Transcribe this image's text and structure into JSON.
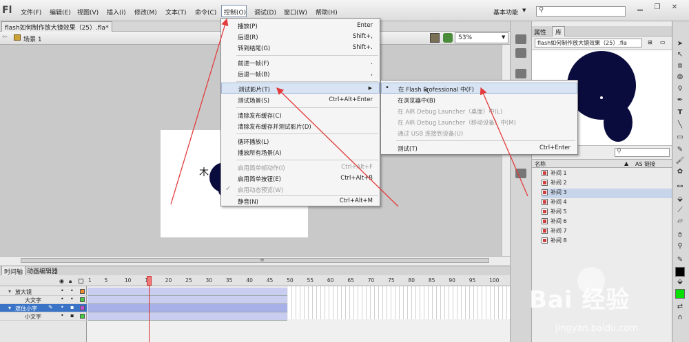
{
  "app": {
    "logo": "Fl"
  },
  "menubar": {
    "items": [
      "文件(F)",
      "编辑(E)",
      "视图(V)",
      "插入(I)",
      "修改(M)",
      "文本(T)",
      "命令(C)",
      "控制(O)",
      "调试(D)",
      "窗口(W)",
      "帮助(H)"
    ],
    "workspace": "基本功能"
  },
  "document": {
    "tab_title": "flash如何制作放大镜效果（25）.fla*",
    "scene": "场景 1",
    "zoom": "53%",
    "stage_glyph": "木"
  },
  "control_menu": {
    "items": [
      {
        "label": "播放(P)",
        "shortcut": "Enter"
      },
      {
        "label": "后退(R)",
        "shortcut": "Shift+,"
      },
      {
        "label": "转到结尾(G)",
        "shortcut": "Shift+."
      },
      {
        "label": "前进一帧(F)",
        "shortcut": "."
      },
      {
        "label": "后退一帧(B)",
        "shortcut": ","
      },
      {
        "label": "测试影片(T)",
        "shortcut": ""
      },
      {
        "label": "测试场景(S)",
        "shortcut": "Ctrl+Alt+Enter"
      },
      {
        "label": "清除发布缓存(C)",
        "shortcut": ""
      },
      {
        "label": "清除发布缓存并测试影片(D)",
        "shortcut": ""
      },
      {
        "label": "循环播放(L)",
        "shortcut": ""
      },
      {
        "label": "播放所有场景(A)",
        "shortcut": ""
      },
      {
        "label": "启用简单帧动作(I)",
        "shortcut": "Ctrl+Alt+F"
      },
      {
        "label": "启用简单按钮(E)",
        "shortcut": "Ctrl+Alt+B"
      },
      {
        "label": "启用动态预览(W)",
        "shortcut": ""
      },
      {
        "label": "静音(N)",
        "shortcut": "Ctrl+Alt+M"
      }
    ],
    "submenu_arrow": "▶",
    "check_mark": "✓"
  },
  "test_movie_submenu": {
    "items": [
      {
        "label": "在 Flash Professional 中(F)",
        "shortcut": ""
      },
      {
        "label": "在浏览器中(B)",
        "shortcut": ""
      },
      {
        "label": "在 AIR Debug Launcher（桌面）中(L)",
        "shortcut": ""
      },
      {
        "label": "在 AIR Debug Launcher（移动设备）中(M)",
        "shortcut": ""
      },
      {
        "label": "通过 USB 连接到设备(U)",
        "shortcut": ""
      },
      {
        "label": "测试(T)",
        "shortcut": "Ctrl+Enter"
      }
    ],
    "bullet": "•"
  },
  "timeline": {
    "tabs": [
      "时间轴",
      "动画编辑器"
    ],
    "ticks": [
      "1",
      "5",
      "10",
      "15",
      "20",
      "25",
      "30",
      "35",
      "40",
      "45",
      "50",
      "55",
      "60",
      "65",
      "70",
      "75",
      "80",
      "85",
      "90",
      "95",
      "100"
    ],
    "layers": [
      "放大镜",
      "大文字",
      "遮住小字",
      "小文字"
    ],
    "current_frame": 15,
    "layer_colors": [
      "#f08a24",
      "#3fcf3f",
      "#c24fd0",
      "#3fcf3f"
    ]
  },
  "library": {
    "tabs": [
      "属性",
      "库"
    ],
    "doc_name": "flash如何制作放大镜效果（25）.fla",
    "column_name": "名称",
    "column_linkage": "AS 链接",
    "items": [
      "补间 1",
      "补间 2",
      "补间 3",
      "补间 4",
      "补间 5",
      "补间 6",
      "补间 7",
      "补间 8"
    ]
  },
  "colors": {
    "accent": "#3b74c6",
    "circle": "#0b0c3e",
    "arrow": "#e33b3b",
    "stroke_swatch": "#000000",
    "fill_swatch": "#00e000"
  },
  "watermark": {
    "brand": "Bai 经验",
    "url": "jingyan.baidu.com"
  }
}
